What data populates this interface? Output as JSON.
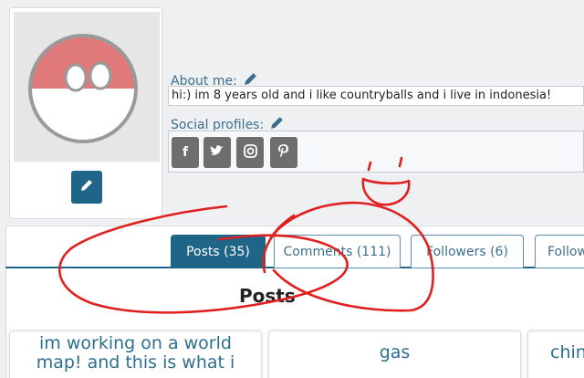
{
  "profile": {
    "about_label": "About me:",
    "about_text": "hi:) im 8 years old and i like countryballs and i live in indonesia!",
    "social_label": "Social profiles:",
    "social_icons": [
      "facebook-icon",
      "twitter-icon",
      "instagram-icon",
      "pinterest-icon"
    ]
  },
  "tabs": [
    {
      "label": "Posts (35)",
      "active": true
    },
    {
      "label": "Comments (111)",
      "active": false
    },
    {
      "label": "Followers (6)",
      "active": false
    },
    {
      "label": "Follow",
      "active": false
    }
  ],
  "posts_heading": "Posts",
  "post_cards": [
    {
      "title": "im working on a world map! and this is what i"
    },
    {
      "title": "gas"
    },
    {
      "title": "chin"
    }
  ],
  "colors": {
    "accent": "#1f6587",
    "link": "#3d6f8c",
    "annotation": "#e02020"
  }
}
